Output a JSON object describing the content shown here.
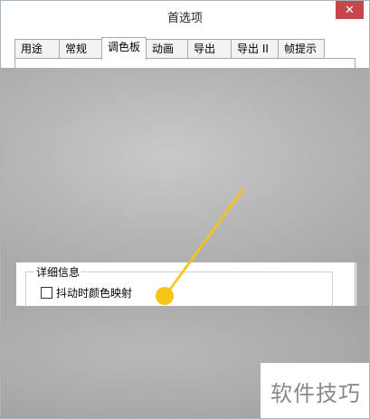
{
  "window": {
    "title": "首选项",
    "close_glyph": "✕"
  },
  "tabs": [
    {
      "label": "用途",
      "active": false
    },
    {
      "label": "常规",
      "active": false
    },
    {
      "label": "调色板",
      "active": true
    },
    {
      "label": "动画",
      "active": false
    },
    {
      "label": "导出",
      "active": false
    },
    {
      "label": "导出 II",
      "active": false
    },
    {
      "label": "帧提示",
      "active": false
    }
  ],
  "details": {
    "group_label": "详细信息",
    "checkbox_label": "抖动时颜色映射",
    "checkbox_checked": false
  },
  "annotation": {
    "color": "#f5c518"
  },
  "watermark": {
    "text": "软件技巧"
  },
  "colors": {
    "close_button": "#c7464b",
    "border": "#aaaaaa"
  }
}
